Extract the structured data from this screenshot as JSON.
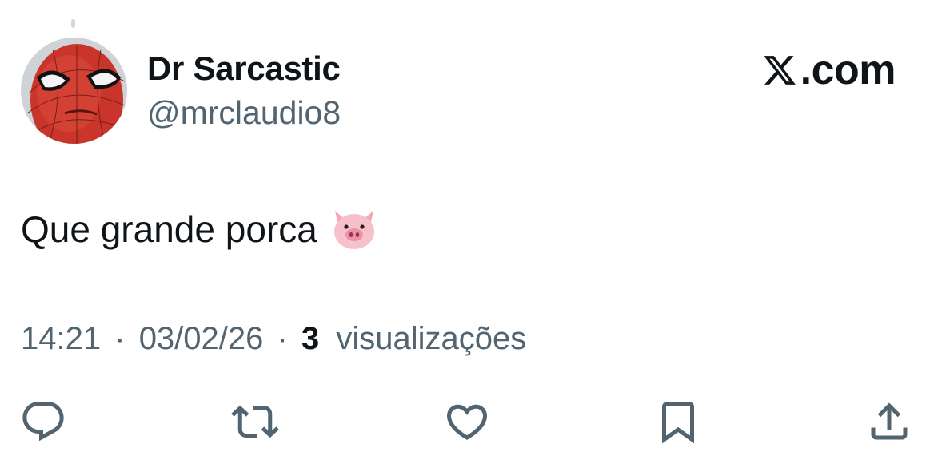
{
  "author": {
    "display_name": "Dr Sarcastic",
    "handle": "@mrclaudio8",
    "avatar_icon": "spiderman-avatar"
  },
  "brand": {
    "logo_icon": "x-logo-icon",
    "domain_suffix": ".com"
  },
  "tweet": {
    "text": "Que grande porca",
    "emoji_icon": "pig-face-icon"
  },
  "meta": {
    "time": "14:21",
    "separator": "·",
    "date": "03/02/26",
    "views_count": "3",
    "views_label": "visualizações"
  },
  "actions": {
    "reply_icon": "reply-icon",
    "retweet_icon": "retweet-icon",
    "like_icon": "heart-icon",
    "bookmark_icon": "bookmark-icon",
    "share_icon": "share-icon"
  },
  "colors": {
    "text_primary": "#0f1419",
    "text_secondary": "#536471",
    "background": "#ffffff"
  }
}
